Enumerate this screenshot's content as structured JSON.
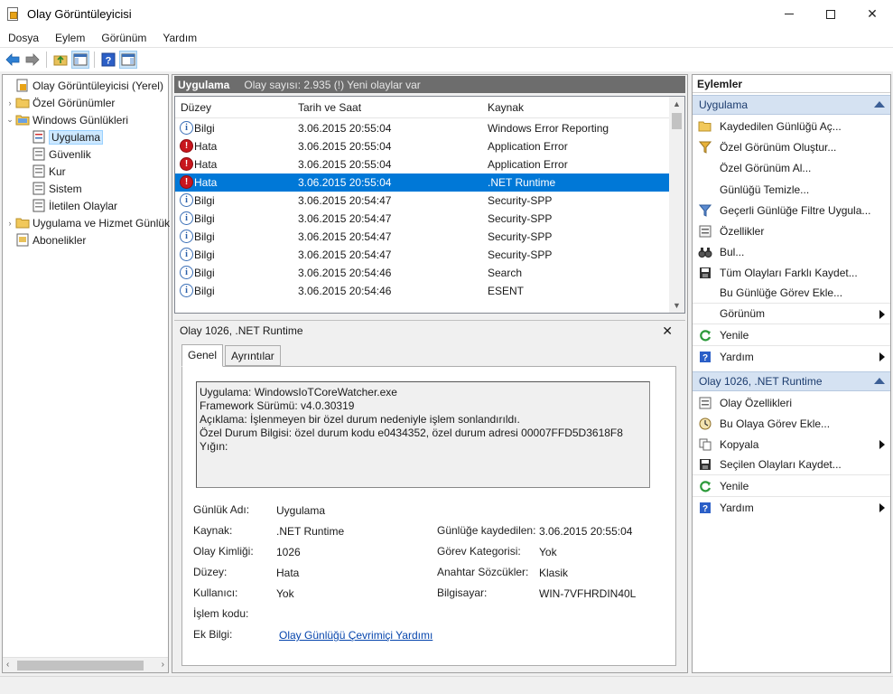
{
  "window": {
    "title": "Olay Görüntüleyicisi",
    "controls": {
      "close": "✕"
    }
  },
  "menu": [
    "Dosya",
    "Eylem",
    "Görünüm",
    "Yardım"
  ],
  "tree": {
    "items": [
      {
        "label": "Olay Görüntüleyicisi (Yerel)",
        "expander": ""
      },
      {
        "label": "Özel Görünümler",
        "expander": "›"
      },
      {
        "label": "Windows Günlükleri",
        "expander": "⌄"
      },
      {
        "label": "Uygulama",
        "expander": ""
      },
      {
        "label": "Güvenlik",
        "expander": ""
      },
      {
        "label": "Kur",
        "expander": ""
      },
      {
        "label": "Sistem",
        "expander": ""
      },
      {
        "label": "İletilen Olaylar",
        "expander": ""
      },
      {
        "label": "Uygulama ve Hizmet Günlük",
        "expander": "›"
      },
      {
        "label": "Abonelikler",
        "expander": ""
      }
    ]
  },
  "list": {
    "title": "Uygulama",
    "count_text": "Olay sayısı: 2.935 (!) Yeni olaylar var",
    "columns": [
      "Düzey",
      "Tarih ve Saat",
      "Kaynak"
    ],
    "rows": [
      {
        "level": "Bilgi",
        "icon": "i",
        "date": "3.06.2015 20:55:04",
        "source": "Windows Error Reporting"
      },
      {
        "level": "Hata",
        "icon": "!",
        "date": "3.06.2015 20:55:04",
        "source": "Application Error"
      },
      {
        "level": "Hata",
        "icon": "!",
        "date": "3.06.2015 20:55:04",
        "source": "Application Error"
      },
      {
        "level": "Hata",
        "icon": "!",
        "date": "3.06.2015 20:55:04",
        "source": ".NET Runtime"
      },
      {
        "level": "Bilgi",
        "icon": "i",
        "date": "3.06.2015 20:54:47",
        "source": "Security-SPP"
      },
      {
        "level": "Bilgi",
        "icon": "i",
        "date": "3.06.2015 20:54:47",
        "source": "Security-SPP"
      },
      {
        "level": "Bilgi",
        "icon": "i",
        "date": "3.06.2015 20:54:47",
        "source": "Security-SPP"
      },
      {
        "level": "Bilgi",
        "icon": "i",
        "date": "3.06.2015 20:54:47",
        "source": "Security-SPP"
      },
      {
        "level": "Bilgi",
        "icon": "i",
        "date": "3.06.2015 20:54:46",
        "source": "Search"
      },
      {
        "level": "Bilgi",
        "icon": "i",
        "date": "3.06.2015 20:54:46",
        "source": "ESENT"
      }
    ]
  },
  "detail": {
    "title": "Olay 1026, .NET Runtime",
    "close": "✕",
    "tabs": [
      "Genel",
      "Ayrıntılar"
    ],
    "description": [
      "Uygulama: WindowsIoTCoreWatcher.exe",
      "Framework Sürümü: v4.0.30319",
      "Açıklama: İşlenmeyen bir özel durum nedeniyle işlem sonlandırıldı.",
      "Özel Durum Bilgisi: özel durum kodu e0434352, özel durum adresi 00007FFD5D3618F8",
      "Yığın:"
    ],
    "props": {
      "log_name_label": "Günlük Adı:",
      "log_name": "Uygulama",
      "source_label": "Kaynak:",
      "source": ".NET Runtime",
      "logged_label": "Günlüğe kaydedilen:",
      "logged": "3.06.2015 20:55:04",
      "event_id_label": "Olay Kimliği:",
      "event_id": "1026",
      "task_label": "Görev Kategorisi:",
      "task": "Yok",
      "level_label": "Düzey:",
      "level": "Hata",
      "keywords_label": "Anahtar Sözcükler:",
      "keywords": "Klasik",
      "user_label": "Kullanıcı:",
      "user": "Yok",
      "computer_label": "Bilgisayar:",
      "computer": "WIN-7VFHRDIN40L",
      "opcode_label": "İşlem kodu:",
      "more_info_label": "Ek Bilgi:",
      "more_info_link": "Olay Günlüğü Çevrimiçi Yardımı"
    }
  },
  "actions": {
    "title": "Eylemler",
    "section1": "Uygulama",
    "items1": [
      "Kaydedilen Günlüğü Aç...",
      "Özel Görünüm Oluştur...",
      "Özel Görünüm Al...",
      "Günlüğü Temizle...",
      "Geçerli Günlüğe Filtre Uygula...",
      "Özellikler",
      "Bul...",
      "Tüm Olayları Farklı Kaydet...",
      "Bu Günlüğe Görev Ekle...",
      "Görünüm",
      "Yenile",
      "Yardım"
    ],
    "section2": "Olay 1026, .NET Runtime",
    "items2": [
      "Olay Özellikleri",
      "Bu Olaya Görev Ekle...",
      "Kopyala",
      "Seçilen Olayları Kaydet...",
      "Yenile",
      "Yardım"
    ]
  },
  "colors": {
    "selection": "#0078d7",
    "error": "#c8161d",
    "info": "#2b5fa8",
    "section": "#d5e2f2"
  }
}
